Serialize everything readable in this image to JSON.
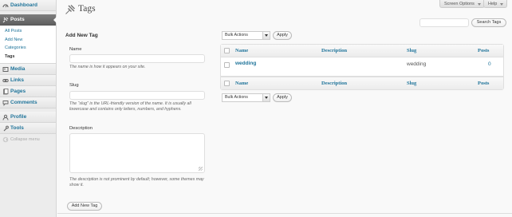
{
  "sidebar": {
    "items": [
      {
        "label": "Dashboard",
        "icon": "dashboard-icon"
      },
      {
        "label": "Posts",
        "icon": "pushpin-icon",
        "current": true
      },
      {
        "label": "Media",
        "icon": "media-icon"
      },
      {
        "label": "Links",
        "icon": "link-icon"
      },
      {
        "label": "Pages",
        "icon": "pages-icon"
      },
      {
        "label": "Comments",
        "icon": "comments-icon"
      },
      {
        "label": "Profile",
        "icon": "profile-icon"
      },
      {
        "label": "Tools",
        "icon": "tools-icon"
      }
    ],
    "posts_submenu": [
      "All Posts",
      "Add New",
      "Categories",
      "Tags"
    ],
    "collapse_label": "Collapse menu"
  },
  "screen_meta": {
    "screen_options": "Screen Options",
    "help": "Help"
  },
  "header": {
    "title": "Tags",
    "icon": "pushpin-icon"
  },
  "search": {
    "value": "",
    "button": "Search Tags"
  },
  "form": {
    "title": "Add New Tag",
    "name_label": "Name",
    "name_value": "",
    "name_desc": "The name is how it appears on your site.",
    "slug_label": "Slug",
    "slug_value": "",
    "slug_desc": "The “slug” is the URL-friendly version of the name. It is usually all lowercase and contains only letters, numbers, and hyphens.",
    "description_label": "Description",
    "description_value": "",
    "description_desc": "The description is not prominent by default; however, some themes may show it.",
    "submit": "Add New Tag"
  },
  "bulk": {
    "select": "Bulk Actions",
    "apply": "Apply"
  },
  "table": {
    "columns": [
      "Name",
      "Description",
      "Slug",
      "Posts"
    ],
    "rows": [
      {
        "name": "wedding",
        "description": "",
        "slug": "wedding",
        "posts": "0"
      }
    ]
  },
  "colors": {
    "link": "#21759b",
    "sidebar_bg": "#ececec",
    "current_menu": "#6d6d6d",
    "page_bg": "#f9f9f9"
  }
}
